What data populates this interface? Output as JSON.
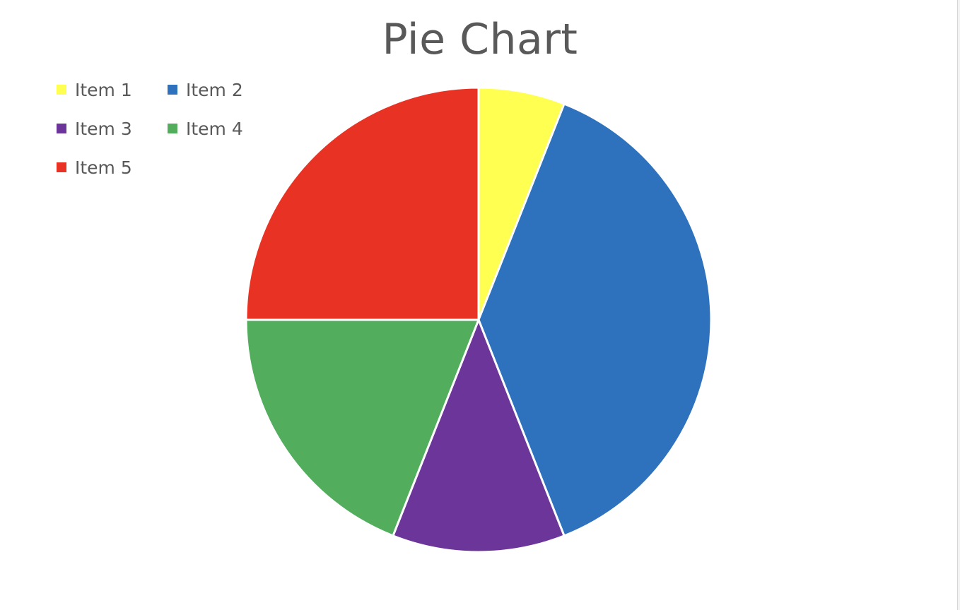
{
  "chart_data": {
    "type": "pie",
    "title": "Pie Chart",
    "categories": [
      "Item 1",
      "Item 2",
      "Item 3",
      "Item 4",
      "Item 5"
    ],
    "values": [
      6,
      38,
      12,
      19,
      25
    ],
    "colors": [
      "#ffff52",
      "#2e72bd",
      "#6b359a",
      "#52ad5c",
      "#e83324"
    ],
    "start": "12 o'clock",
    "direction": "clockwise",
    "legend": "top-left",
    "slice_border_color": "#ffffff"
  }
}
